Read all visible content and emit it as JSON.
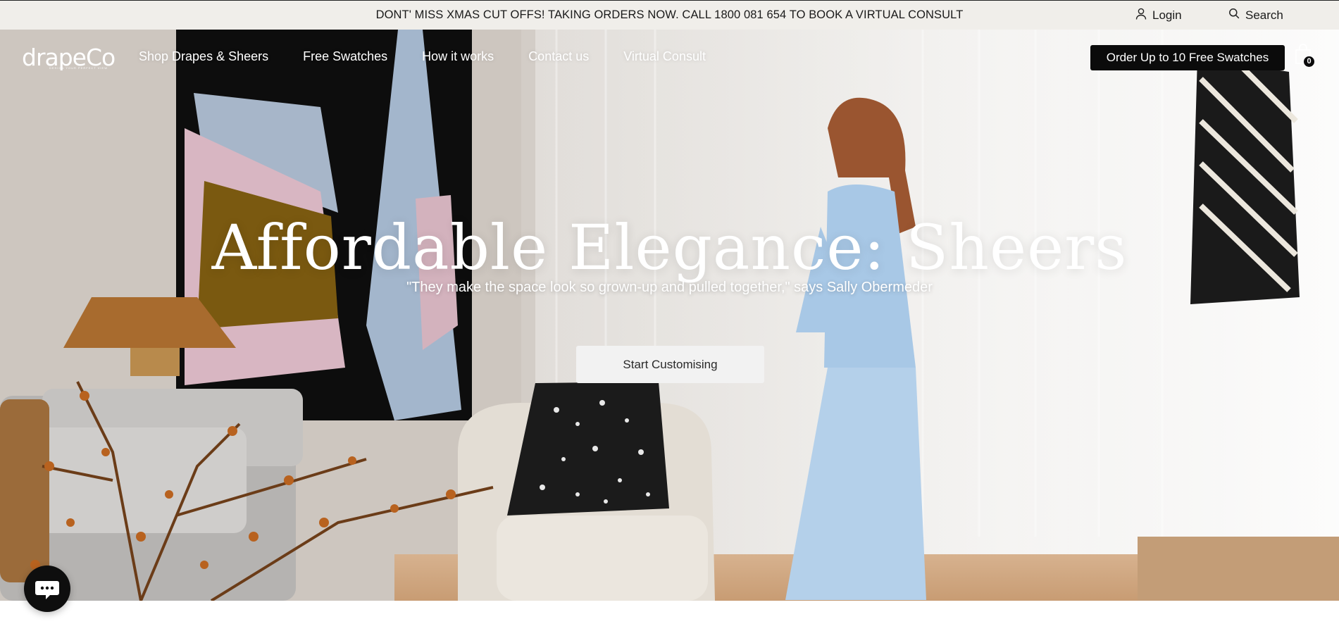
{
  "announcement": {
    "message": "DONT' MISS XMAS CUT OFFS! TAKING ORDERS NOW. CALL 1800 081 654 TO BOOK A VIRTUAL CONSULT",
    "login_label": "Login",
    "search_label": "Search"
  },
  "brand": {
    "logo_text": "drapeCo",
    "tagline": "DESIGN YOUR PERFECT VIEW"
  },
  "nav": {
    "items": [
      {
        "label": "Shop Drapes & Sheers"
      },
      {
        "label": "Free Swatches"
      },
      {
        "label": "How it works"
      },
      {
        "label": "Contact us"
      },
      {
        "label": "Virtual Consult"
      }
    ],
    "cta_label": "Order Up to 10 Free Swatches",
    "cart_count": "0"
  },
  "hero": {
    "headline": "Affordable Elegance: Sheers",
    "quote": "\"They make the space look so grown-up and pulled together,\" says Sally Obermeder",
    "button_label": "Start Customising"
  },
  "icons": {
    "login": "user-icon",
    "search": "search-icon",
    "cart": "shopping-bag-icon",
    "chat": "chat-bubble-icon"
  },
  "colors": {
    "announcement_bg": "#f0eeea",
    "cta_bg": "#0b0b0b",
    "hero_button_bg": "#f2f2f2",
    "text_light": "#ffffff"
  }
}
